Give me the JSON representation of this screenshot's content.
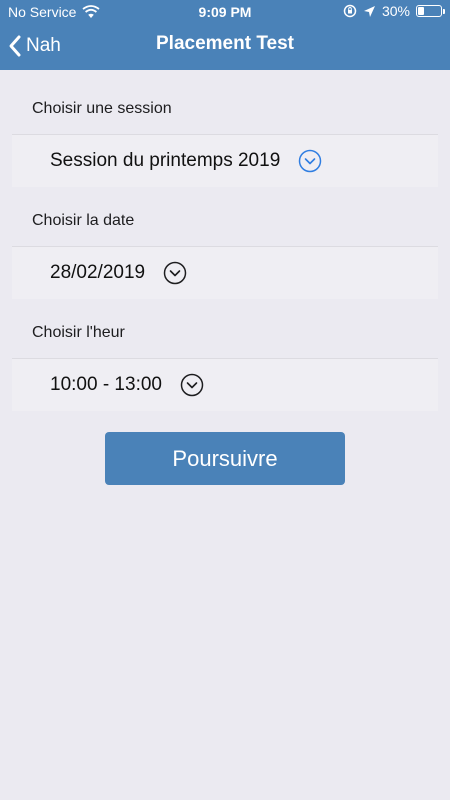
{
  "status_bar": {
    "carrier": "No Service",
    "time": "9:09 PM",
    "battery_percent_text": "30%",
    "battery_level": 0.3
  },
  "nav": {
    "back_label": "Nah",
    "title": "Placement Test"
  },
  "form": {
    "session": {
      "label": "Choisir une session",
      "value": "Session du printemps 2019",
      "icon": "chevron-down-circle-icon",
      "icon_color": "#2f7de1"
    },
    "date": {
      "label": "Choisir la date",
      "value": "28/02/2019",
      "icon": "chevron-down-circle-icon",
      "icon_color": "#1d1d1f"
    },
    "hour": {
      "label": "Choisir l'heur",
      "value": "10:00 - 13:00",
      "icon": "chevron-down-circle-icon",
      "icon_color": "#1d1d1f"
    }
  },
  "continue_button_label": "Poursuivre",
  "colors": {
    "header": "#4a82b8",
    "background": "#ebeaf1",
    "row": "#efeef3"
  }
}
